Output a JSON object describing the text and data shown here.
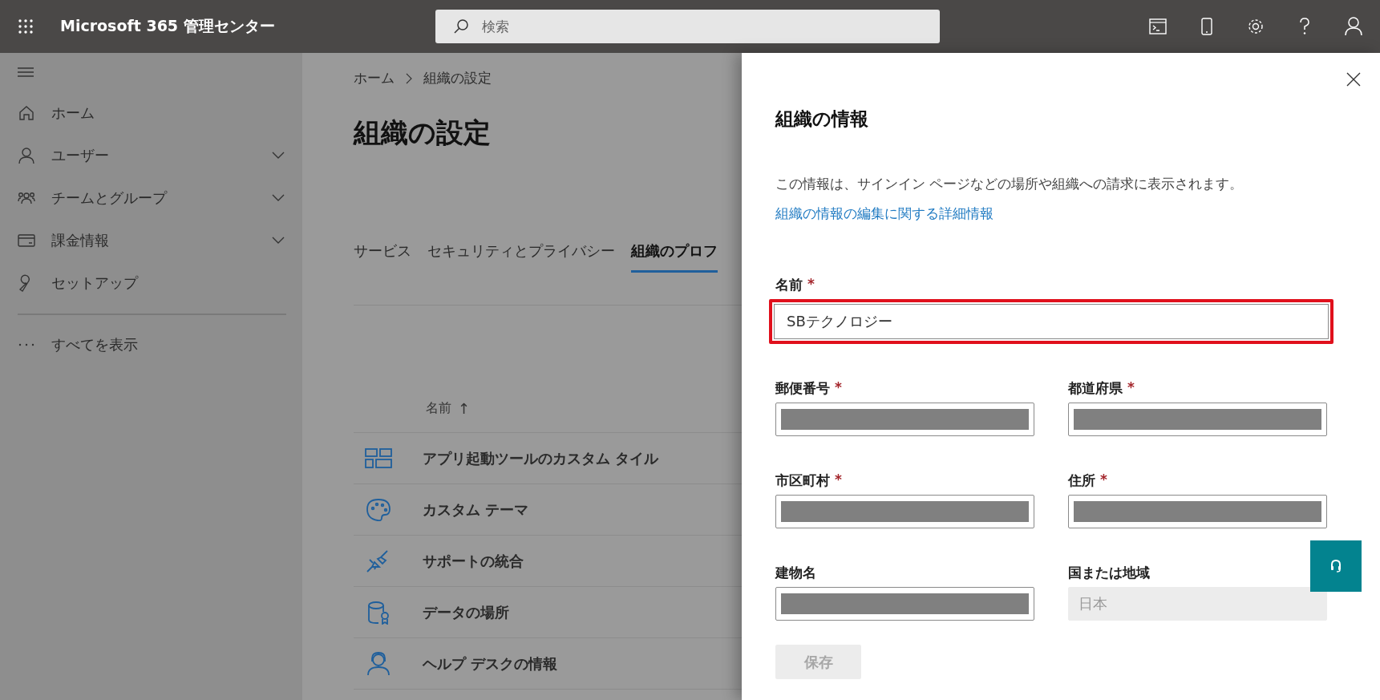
{
  "top_bar": {
    "title": "Microsoft 365 管理センター",
    "search": {
      "placeholder": "検索"
    }
  },
  "sidebar": {
    "items": [
      {
        "label": "ホーム",
        "kind": "link"
      },
      {
        "label": "ユーザー",
        "kind": "group",
        "expanded": false
      },
      {
        "label": "チームとグループ",
        "kind": "group",
        "expanded": false
      },
      {
        "label": "課金情報",
        "kind": "group",
        "expanded": false
      },
      {
        "label": "セットアップ",
        "kind": "link"
      }
    ],
    "show_all": "すべてを表示"
  },
  "main": {
    "breadcrumb": [
      "ホーム",
      "組織の設定"
    ],
    "title": "組織の設定",
    "tabs": [
      {
        "label": "サービス",
        "selected": false
      },
      {
        "label": "セキュリティとプライバシー",
        "selected": false
      },
      {
        "label": "組織のプロフ",
        "selected": true
      }
    ],
    "table": {
      "column": "名前",
      "sort_indicator": "↑",
      "rows": [
        "アプリ起動ツールのカスタム タイル",
        "カスタム テーマ",
        "サポートの統合",
        "データの場所",
        "ヘルプ デスクの情報"
      ]
    }
  },
  "panel": {
    "title": "組織の情報",
    "description": "この情報は、サインイン ページなどの場所や組織への請求に表示されます。",
    "link": "組織の情報の編集に関する詳細情報",
    "fields": [
      {
        "label": "名前",
        "required_mark": "*",
        "value": "SBテクノロジー",
        "kind": "text",
        "highlighted": true,
        "wide": true
      },
      {
        "label": "郵便番号",
        "required_mark": "*",
        "kind": "redacted",
        "highlighted": false,
        "wide": false
      },
      {
        "label": "都道府県",
        "required_mark": "*",
        "kind": "redacted",
        "highlighted": false,
        "wide": false
      },
      {
        "label": "市区町村",
        "required_mark": "*",
        "kind": "redacted",
        "highlighted": false,
        "wide": false
      },
      {
        "label": "住所",
        "required_mark": "*",
        "kind": "redacted",
        "highlighted": false,
        "wide": false
      },
      {
        "label": "建物名",
        "kind": "redacted",
        "highlighted": false,
        "wide": false
      },
      {
        "label": "国または地域",
        "value": "日本",
        "kind": "disabled",
        "highlighted": false,
        "wide": false
      }
    ],
    "save_button": {
      "label": "保存",
      "disabled": true
    }
  }
}
